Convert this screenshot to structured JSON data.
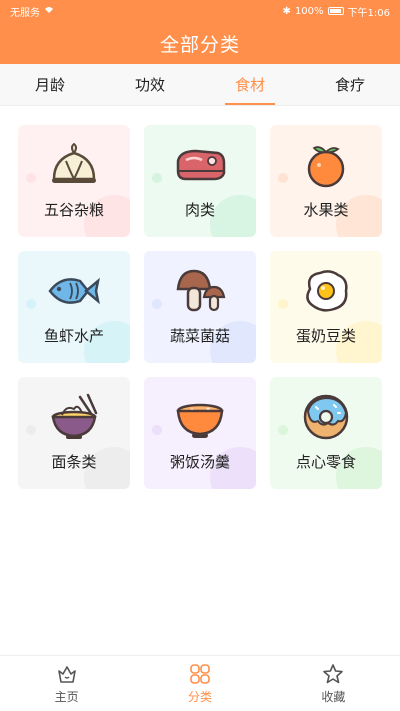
{
  "statusbar": {
    "left": "无服务",
    "battery": "100%",
    "time": "下午1:06"
  },
  "header": {
    "title": "全部分类"
  },
  "tabs": [
    {
      "label": "月龄"
    },
    {
      "label": "功效"
    },
    {
      "label": "食材",
      "active": true
    },
    {
      "label": "食疗"
    }
  ],
  "categories": [
    {
      "label": "五谷杂粮",
      "icon": "steamed-bun-icon"
    },
    {
      "label": "肉类",
      "icon": "meat-icon"
    },
    {
      "label": "水果类",
      "icon": "orange-icon"
    },
    {
      "label": "鱼虾水产",
      "icon": "fish-icon"
    },
    {
      "label": "蔬菜菌菇",
      "icon": "mushroom-icon"
    },
    {
      "label": "蛋奶豆类",
      "icon": "egg-icon"
    },
    {
      "label": "面条类",
      "icon": "noodle-bowl-icon"
    },
    {
      "label": "粥饭汤羹",
      "icon": "soup-bowl-icon"
    },
    {
      "label": "点心零食",
      "icon": "donut-icon"
    }
  ],
  "bottom_nav": [
    {
      "label": "主页",
      "icon": "home-crown-icon"
    },
    {
      "label": "分类",
      "icon": "grid-category-icon",
      "active": true
    },
    {
      "label": "收藏",
      "icon": "star-icon"
    }
  ],
  "colors": {
    "accent": "#ff8f4a"
  }
}
